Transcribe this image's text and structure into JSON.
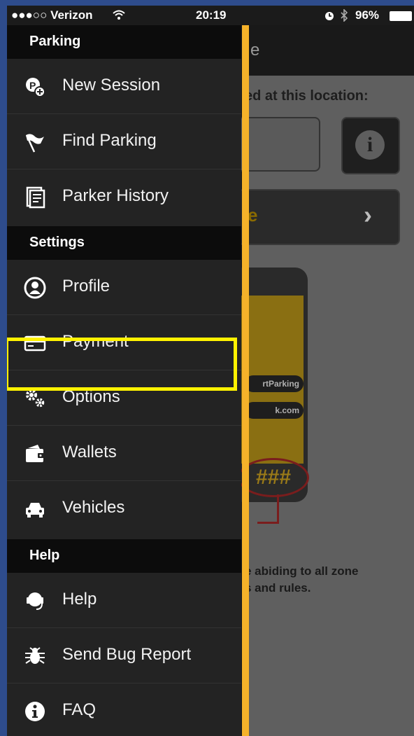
{
  "status_bar": {
    "carrier": "●●●○○ Verizon",
    "time": "20:19",
    "battery": "96%"
  },
  "colors": {
    "accent_edge": "#f5b22a",
    "highlight": "#fff200"
  },
  "background_app": {
    "title_fragment": "e",
    "prompt": "ed at this location:",
    "cta_fragment": "e",
    "footer_line1": "e abiding to all zone",
    "footer_line2": "s and rules.",
    "phone_pills": [
      "rtParking",
      "k.com"
    ],
    "hash_text": "###"
  },
  "drawer": {
    "sections": [
      {
        "title": "Parking",
        "items": [
          {
            "label": "New Session",
            "icon": "new-session-icon"
          },
          {
            "label": "Find Parking",
            "icon": "flag-icon"
          },
          {
            "label": "Parker History",
            "icon": "history-icon"
          }
        ]
      },
      {
        "title": "Settings",
        "items": [
          {
            "label": "Profile",
            "icon": "profile-icon"
          },
          {
            "label": "Payment",
            "icon": "credit-card-icon"
          },
          {
            "label": "Options",
            "icon": "gears-icon"
          },
          {
            "label": "Wallets",
            "icon": "wallet-icon"
          },
          {
            "label": "Vehicles",
            "icon": "car-icon"
          }
        ]
      },
      {
        "title": "Help",
        "items": [
          {
            "label": "Help",
            "icon": "headset-icon"
          },
          {
            "label": "Send Bug Report",
            "icon": "bug-icon"
          },
          {
            "label": "FAQ",
            "icon": "info-icon"
          }
        ]
      }
    ]
  }
}
